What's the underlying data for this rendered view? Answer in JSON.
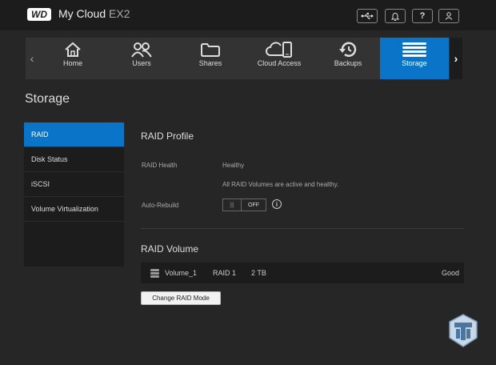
{
  "header": {
    "logo_text": "WD",
    "product_name": "My Cloud",
    "product_model": "EX2",
    "icons": [
      "usb-icon",
      "bell-icon",
      "help-icon",
      "user-icon"
    ],
    "help_label": "?"
  },
  "nav": {
    "items": [
      {
        "label": "Home",
        "icon": "home-icon"
      },
      {
        "label": "Users",
        "icon": "users-icon"
      },
      {
        "label": "Shares",
        "icon": "folder-icon"
      },
      {
        "label": "Cloud Access",
        "icon": "cloud-access-icon"
      },
      {
        "label": "Backups",
        "icon": "backups-icon"
      },
      {
        "label": "Storage",
        "icon": "storage-icon",
        "active": true
      }
    ]
  },
  "page": {
    "title": "Storage"
  },
  "sidebar": {
    "items": [
      {
        "label": "RAID",
        "active": true
      },
      {
        "label": "Disk Status"
      },
      {
        "label": "iSCSI"
      },
      {
        "label": "Volume Virtualization"
      }
    ]
  },
  "raid_profile": {
    "title": "RAID Profile",
    "health_label": "RAID Health",
    "health_value": "Healthy",
    "health_detail": "All RAID Volumes are active and healthy.",
    "autorebuild_label": "Auto-Rebuild",
    "autorebuild_grip": "|||",
    "autorebuild_state": "OFF",
    "info_glyph": "i"
  },
  "raid_volume": {
    "title": "RAID Volume",
    "volumes": [
      {
        "name": "Volume_1",
        "raid": "RAID 1",
        "size": "2 TB",
        "status": "Good"
      }
    ],
    "change_button": "Change RAID Mode"
  },
  "colors": {
    "accent": "#0a74c8",
    "background": "#262626",
    "panel": "#1c1c1c"
  }
}
